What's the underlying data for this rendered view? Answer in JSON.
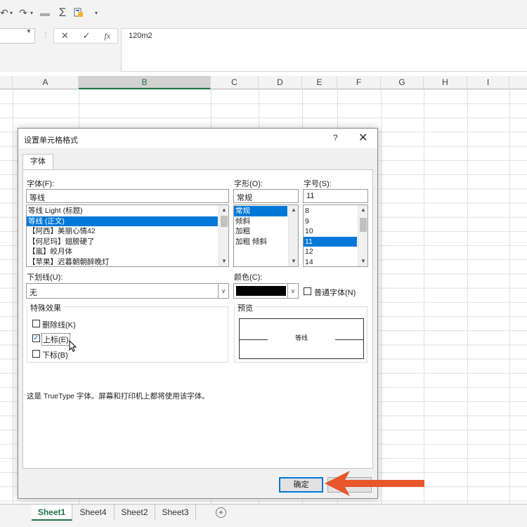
{
  "formula_bar": {
    "cancel_icon": "✕",
    "enter_icon": "✓",
    "fx_label": "fx",
    "content": "120m2"
  },
  "columns": [
    "A",
    "B",
    "C",
    "D",
    "E",
    "F",
    "G",
    "H",
    "I"
  ],
  "selected_column": "B",
  "sheets": [
    "Sheet1",
    "Sheet4",
    "Sheet2",
    "Sheet3"
  ],
  "active_sheet": "Sheet1",
  "dialog": {
    "title": "设置单元格格式",
    "help": "?",
    "close": "✕",
    "tab": "字体",
    "font_label": "字体(F):",
    "font_value": "等线",
    "font_list": [
      "等线 Light (标题)",
      "等线 (正文)",
      "【阿西】美丽心情42",
      "【何尼玛】翅膀硬了",
      "【嵐】皎月体",
      "【苹果】迟暮朝朝醉晚灯"
    ],
    "font_list_selected": 1,
    "style_label": "字形(O):",
    "style_value": "常规",
    "style_list": [
      "常规",
      "倾斜",
      "加粗",
      "加粗 倾斜"
    ],
    "style_list_selected": 0,
    "size_label": "字号(S):",
    "size_value": "11",
    "size_list": [
      "8",
      "9",
      "10",
      "11",
      "12",
      "14"
    ],
    "size_list_selected": 3,
    "underline_label": "下划线(U):",
    "underline_value": "无",
    "color_label": "颜色(C):",
    "color_value": "#000000",
    "normal_font_label": "普通字体(N)",
    "effects_title": "特殊效果",
    "strikethrough_label": "删除线(K)",
    "strikethrough_checked": false,
    "superscript_label": "上标(E)",
    "superscript_checked": true,
    "subscript_label": "下标(B)",
    "subscript_checked": false,
    "preview_title": "预览",
    "preview_text": "等线",
    "info_text": "这是 TrueType 字体。屏幕和打印机上都将使用该字体。",
    "ok_label": "确定"
  },
  "annotation": {
    "arrow_color": "#e8562a"
  }
}
